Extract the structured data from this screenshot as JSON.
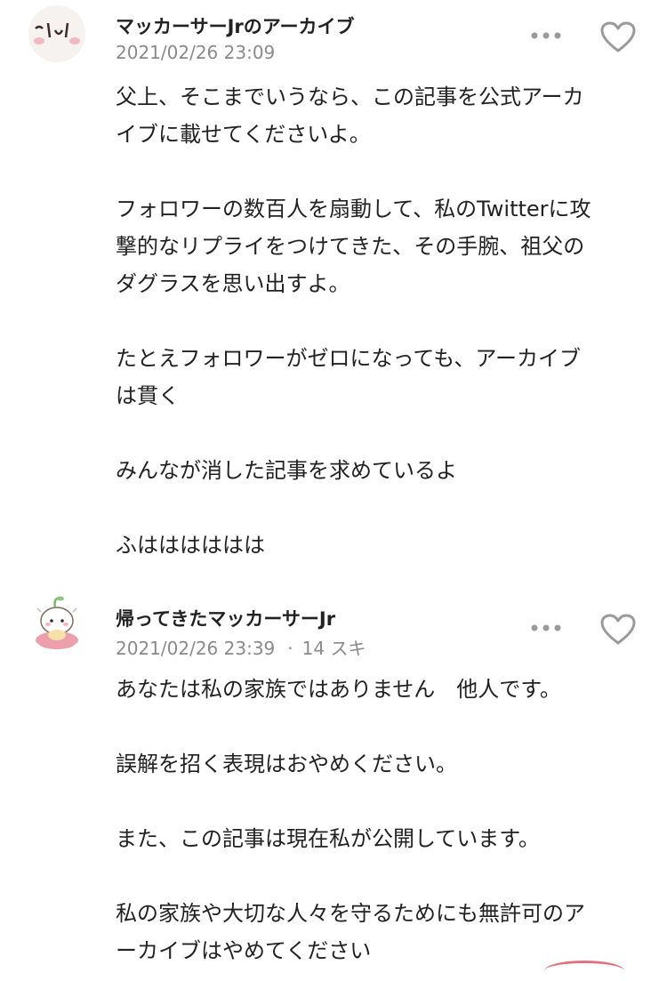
{
  "comments": [
    {
      "author": "マッカーサーJrのアーカイブ",
      "date": "2021/02/26 23:09",
      "likes": "",
      "avatar_icon": "face-sticker-avatar",
      "lines": [
        "父上、そこまでいうなら、この記事を公式アーカ",
        "イブに載せてくださいよ。",
        "",
        "フォロワーの数百人を扇動して、私のTwitterに攻",
        "撃的なリプライをつけてきた、その手腕、祖父の",
        "ダグラスを思い出すよ。",
        "",
        "たとえフォロワーがゼロになっても、アーカイブ",
        "は貫く",
        "",
        "みんなが消した記事を求めているよ",
        "",
        "ふはははははは"
      ]
    },
    {
      "author": "帰ってきたマッカーサーJr",
      "date": "2021/02/26 23:39",
      "separator": "·",
      "likes": "14 スキ",
      "avatar_icon": "character-illustration-avatar",
      "lines": [
        "あなたは私の家族ではありません　他人です。",
        "",
        "誤解を招く表現はおやめください。",
        "",
        "また、この記事は現在私が公開しています。",
        "",
        "私の家族や大切な人々を守るためにも無許可のア",
        "ーカイブはやめてください"
      ]
    }
  ],
  "icons": {
    "more": "more-dots-icon",
    "like": "heart-outline-icon"
  },
  "colors": {
    "text": "#222222",
    "meta": "#8a8a8a",
    "icon": "#9a9a9a"
  }
}
